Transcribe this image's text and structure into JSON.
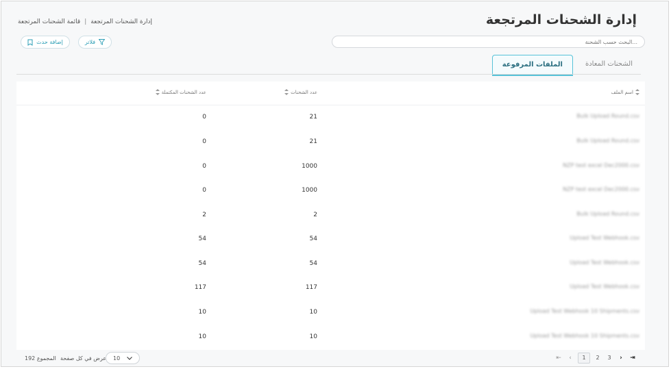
{
  "header": {
    "title": "إدارة الشحنات المرتجعة",
    "breadcrumb": [
      "قائمة الشحنات المرتجعة",
      "إدارة الشحنات المرتجعة"
    ],
    "breadcrumb_sep": "|"
  },
  "search": {
    "placeholder": "...البحث حسب الشحنة"
  },
  "actions": {
    "add_label": "إضافة حدث",
    "filter_label": "فلاتر"
  },
  "tabs": [
    {
      "label": "الشحنات المعادة",
      "active": false
    },
    {
      "label": "الملفات المرفوعة",
      "active": true
    }
  ],
  "table": {
    "columns": {
      "file_name": "اسم الملف",
      "shipments_count": "عدد الشحنات",
      "completed_count": "عدد الشحنات المكتملة"
    },
    "rows": [
      {
        "file_name": "Bulk Upload Round.csv",
        "shipments_count": "21",
        "completed_count": "0"
      },
      {
        "file_name": "Bulk Upload Round.csv",
        "shipments_count": "21",
        "completed_count": "0"
      },
      {
        "file_name": "NZP test excel Dec2000.csv",
        "shipments_count": "1000",
        "completed_count": "0"
      },
      {
        "file_name": "NZP test excel Dec2000.csv",
        "shipments_count": "1000",
        "completed_count": "0"
      },
      {
        "file_name": "Bulk Upload Round.csv",
        "shipments_count": "2",
        "completed_count": "2"
      },
      {
        "file_name": "Upload Test Webhook.csv",
        "shipments_count": "54",
        "completed_count": "54"
      },
      {
        "file_name": "Upload Test Webhook.csv",
        "shipments_count": "54",
        "completed_count": "54"
      },
      {
        "file_name": "Upload Test Webhook.csv",
        "shipments_count": "117",
        "completed_count": "117"
      },
      {
        "file_name": "Upload Test Webhook 10 Shipments.csv",
        "shipments_count": "10",
        "completed_count": "10"
      },
      {
        "file_name": "Upload Test Webhook 10 Shipments.csv",
        "shipments_count": "10",
        "completed_count": "10"
      }
    ]
  },
  "footer": {
    "total_label": "المجموع 192",
    "per_page_label": "عرض في كل صفحة",
    "per_page_value": "10",
    "pages": [
      "1",
      "2",
      "3"
    ],
    "current_page": "1"
  },
  "colors": {
    "accent": "#55c2d8",
    "accent_text": "#2a9db5"
  }
}
